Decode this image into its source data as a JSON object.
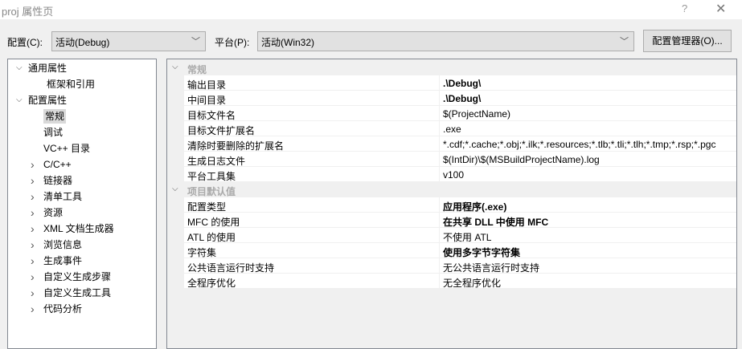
{
  "window": {
    "title": "proj 属性页",
    "help": "?",
    "close": "✕"
  },
  "toolbar": {
    "config_label": "配置(C):",
    "config_value": "活动(Debug)",
    "platform_label": "平台(P):",
    "platform_value": "活动(Win32)",
    "manager_button": "配置管理器(O)..."
  },
  "tree": [
    {
      "label": "通用属性",
      "level": 0,
      "expander": "expanded"
    },
    {
      "label": "框架和引用",
      "level": 1,
      "expander": "none"
    },
    {
      "label": "配置属性",
      "level": 0,
      "expander": "expanded"
    },
    {
      "label": "常规",
      "level": 1,
      "expander": "none",
      "selected": true
    },
    {
      "label": "调试",
      "level": 1,
      "expander": "none"
    },
    {
      "label": "VC++ 目录",
      "level": 1,
      "expander": "none"
    },
    {
      "label": "C/C++",
      "level": 1,
      "expander": "collapsed"
    },
    {
      "label": "链接器",
      "level": 1,
      "expander": "collapsed"
    },
    {
      "label": "清单工具",
      "level": 1,
      "expander": "collapsed"
    },
    {
      "label": "资源",
      "level": 1,
      "expander": "collapsed"
    },
    {
      "label": "XML 文档生成器",
      "level": 1,
      "expander": "collapsed"
    },
    {
      "label": "浏览信息",
      "level": 1,
      "expander": "collapsed"
    },
    {
      "label": "生成事件",
      "level": 1,
      "expander": "collapsed"
    },
    {
      "label": "自定义生成步骤",
      "level": 1,
      "expander": "collapsed"
    },
    {
      "label": "自定义生成工具",
      "level": 1,
      "expander": "collapsed"
    },
    {
      "label": "代码分析",
      "level": 1,
      "expander": "collapsed"
    }
  ],
  "grid": [
    {
      "category": "常规",
      "rows": [
        {
          "name": "输出目录",
          "value": ".\\Debug\\",
          "bold": true
        },
        {
          "name": "中间目录",
          "value": ".\\Debug\\",
          "bold": true
        },
        {
          "name": "目标文件名",
          "value": "$(ProjectName)"
        },
        {
          "name": "目标文件扩展名",
          "value": ".exe"
        },
        {
          "name": "清除时要删除的扩展名",
          "value": "*.cdf;*.cache;*.obj;*.ilk;*.resources;*.tlb;*.tli;*.tlh;*.tmp;*.rsp;*.pgc"
        },
        {
          "name": "生成日志文件",
          "value": "$(IntDir)\\$(MSBuildProjectName).log"
        },
        {
          "name": "平台工具集",
          "value": "v100"
        }
      ]
    },
    {
      "category": "项目默认值",
      "rows": [
        {
          "name": "配置类型",
          "value": "应用程序(.exe)",
          "bold": true
        },
        {
          "name": "MFC 的使用",
          "value": "在共享 DLL 中使用 MFC",
          "bold": true
        },
        {
          "name": "ATL 的使用",
          "value": "不使用 ATL"
        },
        {
          "name": "字符集",
          "value": "使用多字节字符集",
          "bold": true
        },
        {
          "name": "公共语言运行时支持",
          "value": "无公共语言运行时支持"
        },
        {
          "name": "全程序优化",
          "value": "无全程序优化"
        }
      ]
    }
  ]
}
